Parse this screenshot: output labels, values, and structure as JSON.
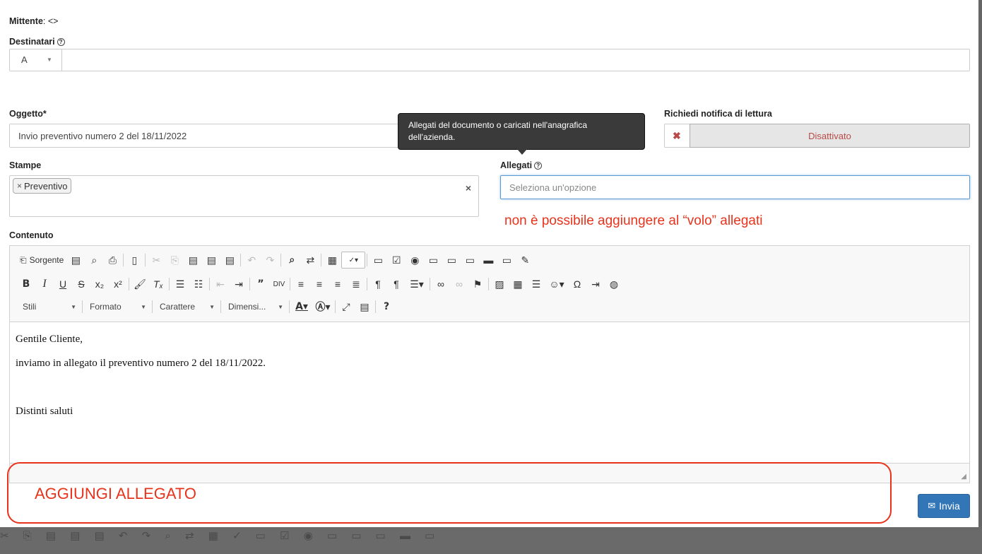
{
  "sender": {
    "label": "Mittente",
    "value": "<>"
  },
  "recipients": {
    "label": "Destinatari",
    "type_value": "A",
    "value": ""
  },
  "subject": {
    "label": "Oggetto*",
    "value": "Invio preventivo numero 2 del 18/11/2022"
  },
  "read_receipt": {
    "label": "Richiedi notifica di lettura",
    "state": "Disattivato"
  },
  "tooltip": {
    "text": "Allegati del documento o caricati nell'anagrafica dell'azienda."
  },
  "prints": {
    "label": "Stampe",
    "tags": [
      "Preventivo"
    ]
  },
  "attachments": {
    "label": "Allegati",
    "placeholder": "Seleziona un'opzione"
  },
  "annotation_note": "non è possibile aggiungere al “volo” allegati",
  "annotation_box_text": "AGGIUNGI ALLEGATO",
  "content": {
    "label": "Contenuto"
  },
  "toolbar": {
    "source_label": "Sorgente",
    "styles": "Stili",
    "format": "Formato",
    "font": "Carattere",
    "size": "Dimensi...",
    "help": "?"
  },
  "editor": {
    "line1": "Gentile Cliente,",
    "line2": "inviamo in allegato il preventivo numero 2 del 18/11/2022.",
    "line3": "Distinti saluti"
  },
  "send_button": "Invia",
  "colors": {
    "primary": "#3376b8",
    "danger": "#b94a48",
    "annotation": "#e8331c"
  }
}
